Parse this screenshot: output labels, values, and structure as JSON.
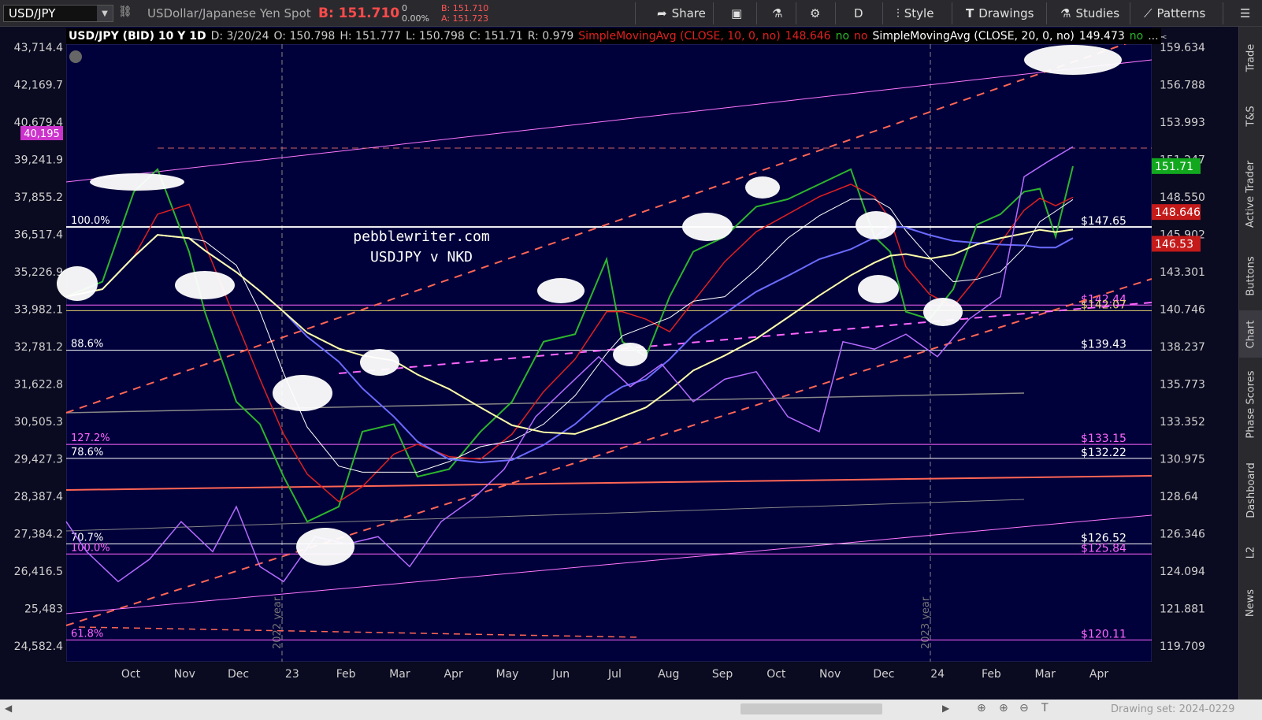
{
  "toolbar": {
    "symbol": "USD/JPY",
    "description": "USDollar/Japanese Yen Spot",
    "bid_label": "B: 151.710",
    "change": "0",
    "change_pct": "0.00%",
    "bid_small": "B: 151.710",
    "ask_small": "A: 151.723",
    "share_label": "Share",
    "period_label": "D",
    "style_label": "Style",
    "drawings_label": "Drawings",
    "studies_label": "Studies",
    "patterns_label": "Patterns"
  },
  "sidebar": {
    "tabs": [
      "Trade",
      "T&S",
      "Active Trader",
      "Buttons",
      "Chart",
      "Phase Scores",
      "Dashboard",
      "L2",
      "News"
    ]
  },
  "legend": {
    "title": "USD/JPY (BID) 10 Y 1D",
    "date": "D: 3/20/24",
    "open": "O: 150.798",
    "high": "H: 151.777",
    "low": "L: 150.798",
    "close": "C: 151.71",
    "range": "R: 0.979",
    "sma10": "SimpleMovingAvg (CLOSE, 10, 0, no)",
    "sma10_val": "148.646",
    "no1": "no",
    "no2": "no",
    "sma20": "SimpleMovingAvg (CLOSE, 20, 0, no)",
    "sma20_val": "149.473",
    "no3": "no",
    "more": "..."
  },
  "chart_data": {
    "type": "line",
    "title": "pebblewriter.com USDJPY v NKD",
    "x_ticks": [
      "Oct",
      "Nov",
      "Dec",
      "23",
      "Feb",
      "Mar",
      "Apr",
      "May",
      "Jun",
      "Jul",
      "Aug",
      "Sep",
      "Oct",
      "Nov",
      "Dec",
      "24",
      "Feb",
      "Mar",
      "Apr"
    ],
    "left_axis": [
      "43,714.4",
      "42,169.7",
      "40,679.4",
      "39,241.9",
      "37,855.2",
      "36,517.4",
      "35,226.9",
      "33,982.1",
      "32,781.2",
      "31,622.8",
      "30,505.3",
      "29,427.3",
      "28,387.4",
      "27,384.2",
      "26,416.5",
      "25,483",
      "24,582.4"
    ],
    "right_axis": [
      "159.634",
      "156.788",
      "153.993",
      "151.247",
      "148.550",
      "145.902",
      "143.301",
      "140.746",
      "138.237",
      "135.773",
      "133.352",
      "130.975",
      "128.64",
      "126.346",
      "124.094",
      "121.881",
      "119.709"
    ],
    "ylim": [
      119.709,
      159.634
    ],
    "nkd_badge": "40,195",
    "price_badges": [
      {
        "label": "151.71",
        "value": 151.71,
        "color": "#12a81e"
      },
      {
        "label": "148.646",
        "value": 148.646,
        "color": "#c41a1a"
      },
      {
        "label": "146.53",
        "value": 146.53,
        "color": "#c41a1a"
      }
    ],
    "levels": [
      {
        "price_label": "$147.65",
        "value": 147.65,
        "fib_label": "100.0%",
        "color": "#ffffff"
      },
      {
        "price_label": "$142.44",
        "value": 142.44,
        "fib_label": "",
        "color": "#ff66ff"
      },
      {
        "price_label": "$142.07",
        "value": 142.07,
        "fib_label": "",
        "color": "#e8d46a"
      },
      {
        "price_label": "$139.43",
        "value": 139.43,
        "fib_label": "88.6%",
        "color": "#ffffff"
      },
      {
        "price_label": "$133.15",
        "value": 133.15,
        "fib_label": "127.2%",
        "color": "#ff66ff"
      },
      {
        "price_label": "$132.22",
        "value": 132.22,
        "fib_label": "78.6%",
        "color": "#ffffff"
      },
      {
        "price_label": "$126.52",
        "value": 126.52,
        "fib_label": "70.7%",
        "color": "#ffffff"
      },
      {
        "price_label": "$125.84",
        "value": 125.84,
        "fib_label": "100.0%",
        "color": "#ff66ff"
      },
      {
        "price_label": "$120.11",
        "value": 120.11,
        "fib_label": "61.8%",
        "color": "#ff66ff"
      }
    ],
    "year_markers": [
      "2022 year",
      "2023 year"
    ],
    "series": [
      {
        "name": "USD/JPY",
        "color": "#2db52d"
      },
      {
        "name": "SimpleMovingAvg (CLOSE, 10, 0, no)",
        "color": "#e02020"
      },
      {
        "name": "SimpleMovingAvg (CLOSE, 20, 0, no)",
        "color": "#ffffff"
      }
    ],
    "grid": true
  },
  "bottombar": {
    "drawing_set": "Drawing set: 2024-0229"
  }
}
